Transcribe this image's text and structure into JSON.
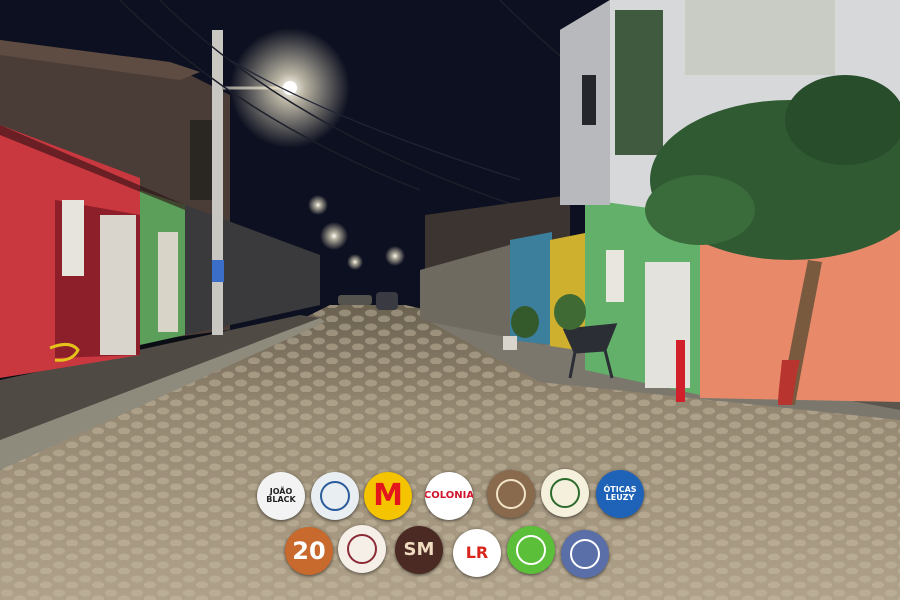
{
  "photo": {
    "subject": "night-street",
    "colors": {
      "sky": "#0d1020",
      "cobblestone": "#a89a82",
      "red_house": "#c9383f",
      "green_house": "#62b06a",
      "orange_wall": "#e88a6a"
    }
  },
  "sponsor_logos": [
    {
      "name": "joao-black",
      "text": "JOÃO BLACK",
      "bg": "#f3f3f3",
      "fg": "#222222"
    },
    {
      "name": "farmacia",
      "text": "",
      "bg": "#e9eef3",
      "fg": "#2a5c9a"
    },
    {
      "name": "m-logo",
      "text": "M",
      "bg": "#f5c400",
      "fg": "#e3161b"
    },
    {
      "name": "colonia",
      "text": "COLONIA",
      "bg": "#ffffff",
      "fg": "#d0142b"
    },
    {
      "name": "saint-portrait",
      "text": "",
      "bg": "#8a6a4c",
      "fg": "#f2e4c8"
    },
    {
      "name": "crest",
      "text": "",
      "bg": "#f4f0dc",
      "fg": "#2c6a2c"
    },
    {
      "name": "oticas-leuzy",
      "text": "ÓTICAS LEUZY",
      "bg": "#1e63b8",
      "fg": "#ffffff"
    },
    {
      "name": "20-logo",
      "text": "20",
      "bg": "#c8692d",
      "fg": "#ffffff"
    },
    {
      "name": "amor-logo",
      "text": "",
      "bg": "#f6efe8",
      "fg": "#8a2b36"
    },
    {
      "name": "sm-modas",
      "text": "SM",
      "bg": "#4a2a22",
      "fg": "#f0dcc0"
    },
    {
      "name": "lr-logo",
      "text": "LR",
      "bg": "#ffffff",
      "fg": "#d9261c"
    },
    {
      "name": "green-logo",
      "text": "",
      "bg": "#5cbf3a",
      "fg": "#ffffff"
    },
    {
      "name": "cat-logo",
      "text": "",
      "bg": "#5a6fa8",
      "fg": "#ffffff"
    }
  ]
}
